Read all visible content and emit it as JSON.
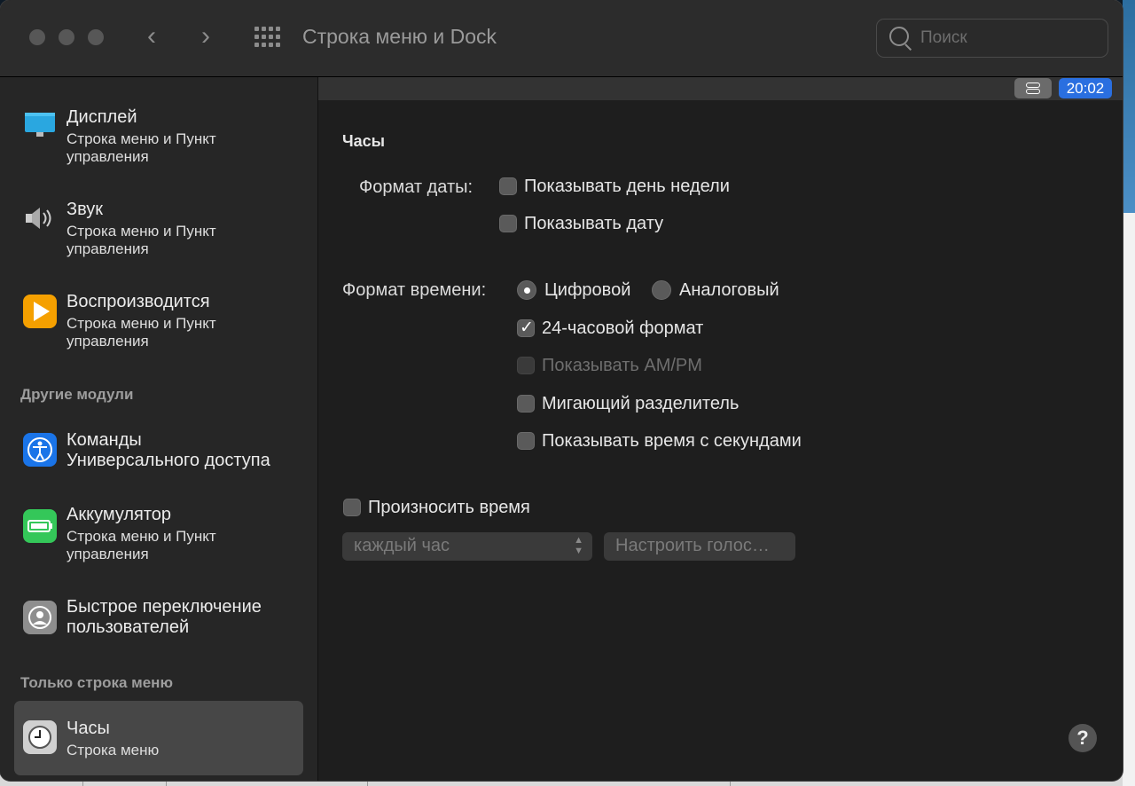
{
  "window": {
    "title": "Строка меню и Dock",
    "nav_back": "‹",
    "nav_forward": "›",
    "search_placeholder": "Поиск"
  },
  "sidebar": {
    "items_top": [
      {
        "title": "Дисплей",
        "subtitle1": "Строка меню и Пункт",
        "subtitle2": "управления",
        "icon": "display-icon"
      },
      {
        "title": "Звук",
        "subtitle1": "Строка меню и Пункт",
        "subtitle2": "управления",
        "icon": "sound-icon"
      },
      {
        "title": "Воспроизводится",
        "subtitle1": "Строка меню и Пункт",
        "subtitle2": "управления",
        "icon": "play-icon"
      }
    ],
    "section_other": "Другие модули",
    "items_other": [
      {
        "title1": "Команды",
        "title2": "Универсального доступа",
        "icon": "accessibility-icon"
      },
      {
        "title": "Аккумулятор",
        "subtitle1": "Строка меню и Пункт",
        "subtitle2": "управления",
        "icon": "battery-icon"
      },
      {
        "title1": "Быстрое переключение",
        "title2": "пользователей",
        "icon": "user-switch-icon"
      }
    ],
    "section_menubar": "Только строка меню",
    "selected_item": {
      "title": "Часы",
      "subtitle": "Строка меню",
      "icon": "clock-icon"
    }
  },
  "menubar_preview": {
    "clock_text": "20:02",
    "control_center_icon": "control-center-icon"
  },
  "clock_panel": {
    "heading": "Часы",
    "date_format_label": "Формат даты:",
    "show_weekday": {
      "label": "Показывать день недели",
      "checked": false
    },
    "show_date": {
      "label": "Показывать дату",
      "checked": false
    },
    "time_format_label": "Формат времени:",
    "digital": {
      "label": "Цифровой",
      "selected": true
    },
    "analog": {
      "label": "Аналоговый",
      "selected": false
    },
    "h24": {
      "label": "24-часовой формат",
      "checked": true
    },
    "ampm": {
      "label": "Показывать AM/PM",
      "checked": false,
      "disabled": true
    },
    "flash_separators": {
      "label": "Мигающий разделитель",
      "checked": false
    },
    "show_seconds": {
      "label": "Показывать время с секундами",
      "checked": false
    },
    "announce_time": {
      "label": "Произносить время",
      "checked": false
    },
    "interval_value": "каждый час",
    "customize_voice": "Настроить голос…",
    "check_glyph": "✓",
    "help": "?"
  },
  "colors": {
    "accent": "#2a6fe0",
    "sidebar_bg": "#262626",
    "window_bg": "#1e1e1e"
  }
}
